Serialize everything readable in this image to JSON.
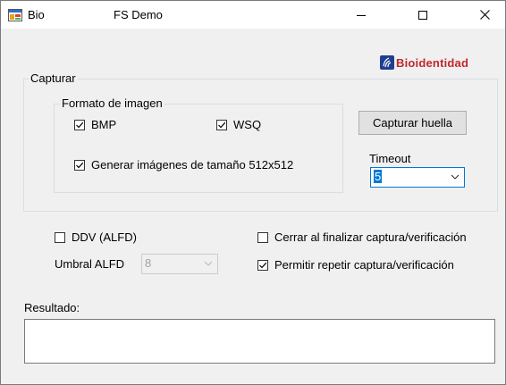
{
  "window": {
    "app_name": "Bio",
    "title": "FS Demo",
    "controls": {
      "minimize": "minimize-icon",
      "maximize": "maximize-icon",
      "close": "close-icon"
    }
  },
  "logo": {
    "text": "Bioidentidad",
    "color": "#c0272d",
    "icon": "fingerprint-logo-icon"
  },
  "capturar": {
    "legend": "Capturar",
    "formato": {
      "legend": "Formato de imagen",
      "bmp": {
        "label": "BMP",
        "checked": true
      },
      "wsq": {
        "label": "WSQ",
        "checked": true
      },
      "resize": {
        "label": "Generar imágenes de tamaño 512x512",
        "checked": true
      }
    },
    "capture_button": "Capturar huella",
    "timeout": {
      "label": "Timeout",
      "value": "5"
    }
  },
  "options": {
    "ddv": {
      "label": "DDV (ALFD)",
      "checked": false
    },
    "umbral": {
      "label": "Umbral ALFD",
      "value": "8",
      "enabled": false
    },
    "cerrar": {
      "label": "Cerrar al finalizar captura/verificación",
      "checked": false
    },
    "permitir": {
      "label": "Permitir repetir captura/verificación",
      "checked": true
    }
  },
  "resultado": {
    "label": "Resultado:",
    "value": ""
  },
  "colors": {
    "accent": "#0078d7",
    "window_bg": "#f0f0f0",
    "brand_red": "#c0272d",
    "brand_blue": "#1f3f8f"
  }
}
